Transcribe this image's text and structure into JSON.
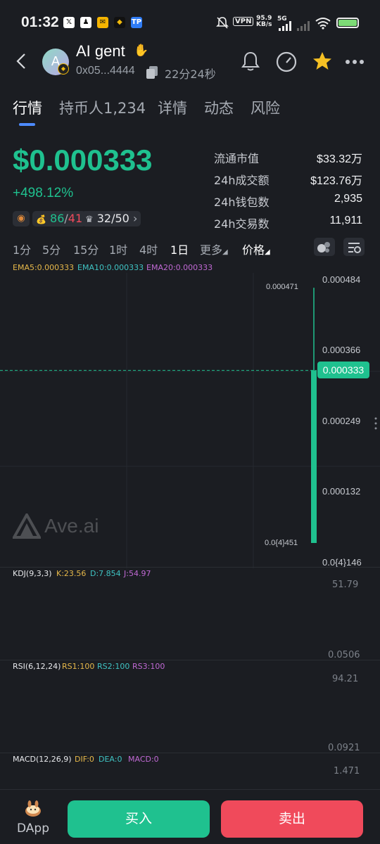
{
  "status_bar": {
    "time": "01:32",
    "net_speed": "95.9",
    "net_unit": "KB/s",
    "signal": "5G",
    "vpn": "VPN"
  },
  "header": {
    "avatar_letter": "A",
    "token_name": "AI gent",
    "address": "0x05...4444",
    "age": "22分24秒"
  },
  "tabs": [
    "行情",
    "持币人1,234",
    "详情",
    "动态",
    "风险"
  ],
  "price": {
    "value": "$0.000333",
    "change": "+498.12%",
    "buys": "86",
    "sells": "41",
    "holders_ratio": "32/50"
  },
  "stats": [
    {
      "label": "流通市值",
      "value": "$33.32万"
    },
    {
      "label": "24h成交额",
      "value": "$123.76万"
    },
    {
      "label": "24h钱包数",
      "value": "2,935"
    },
    {
      "label": "24h交易数",
      "value": "11,911"
    }
  ],
  "timeframes": [
    "1分",
    "5分",
    "15分",
    "1时",
    "4时",
    "1日",
    "更多",
    "价格"
  ],
  "ema": {
    "ema5": "EMA5:0.000333",
    "ema10": "EMA10:0.000333",
    "ema20": "EMA20:0.000333"
  },
  "chart": {
    "watermark": "Ave.ai",
    "y_labels": [
      "0.000484",
      "0.000366",
      "0.000249",
      "0.000132",
      "0.0{4}146"
    ],
    "current_price_label": "0.000333",
    "high_label": "0.000471",
    "low_label": "0.0{4}451"
  },
  "chart_data": {
    "type": "candlestick",
    "ylim": [
      1.46e-05,
      0.000484
    ],
    "candles": [
      {
        "open": 4.51e-05,
        "high": 0.000471,
        "low": 4.51e-05,
        "close": 0.000333
      }
    ],
    "current": 0.000333,
    "colors": {
      "up": "#1fc18f",
      "down": "#f04a5b"
    }
  },
  "kdj": {
    "title": "KDJ(9,3,3)",
    "k": "K:23.56",
    "d": "D:7.854",
    "j": "J:54.97",
    "top": "51.79",
    "bottom": "0.0506"
  },
  "rsi": {
    "title": "RSI(6,12,24)",
    "rs1": "RS1:100",
    "rs2": "RS2:100",
    "rs3": "RS3:100",
    "top": "94.21",
    "bottom": "0.0921"
  },
  "macd": {
    "title": "MACD(12,26,9)",
    "dif": "DIF:0",
    "dea": "DEA:0",
    "macd": "MACD:0",
    "top": "1.471"
  },
  "bottom_bar": {
    "dapp": "DApp",
    "buy": "买入",
    "sell": "卖出"
  },
  "colors": {
    "green": "#1fc18f",
    "red": "#f04a5b",
    "accent": "#4d8bff",
    "star": "#f5c024"
  }
}
